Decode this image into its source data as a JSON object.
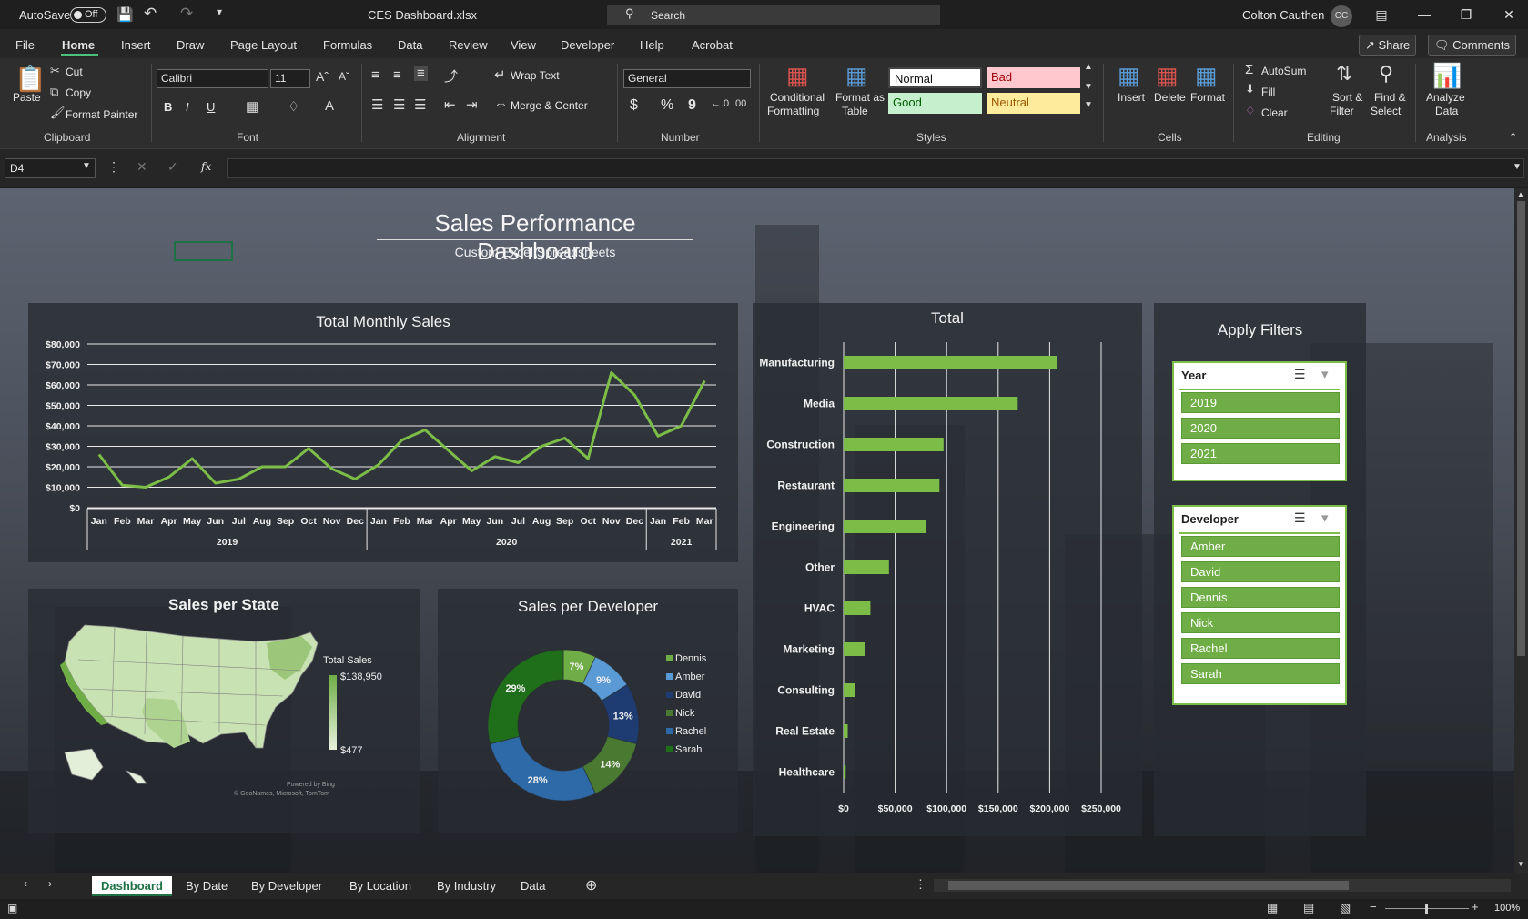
{
  "titlebar": {
    "autosave_label": "AutoSave",
    "autosave_state": "Off",
    "filename": "CES Dashboard.xlsx",
    "search_placeholder": "Search",
    "user_name": "Colton Cauthen",
    "user_initials": "CC"
  },
  "menu": {
    "items": [
      "File",
      "Home",
      "Insert",
      "Draw",
      "Page Layout",
      "Formulas",
      "Data",
      "Review",
      "View",
      "Developer",
      "Help",
      "Acrobat"
    ],
    "active": "Home",
    "share_label": "Share",
    "comments_label": "Comments"
  },
  "ribbon": {
    "clipboard": {
      "paste": "Paste",
      "cut": "Cut",
      "copy": "Copy",
      "format_painter": "Format Painter",
      "label": "Clipboard"
    },
    "font": {
      "name": "Calibri",
      "size": "11",
      "label": "Font",
      "bold": "B",
      "italic": "I",
      "underline": "U"
    },
    "alignment": {
      "wrap_text": "Wrap Text",
      "merge_center": "Merge & Center",
      "label": "Alignment"
    },
    "number": {
      "format": "General",
      "label": "Number",
      "currency": "$",
      "percent": "%",
      "comma": "9"
    },
    "styles": {
      "conditional_formatting": [
        "Conditional",
        "Formatting"
      ],
      "format_as_table": [
        "Format as",
        "Table"
      ],
      "normal": "Normal",
      "bad": "Bad",
      "good": "Good",
      "neutral": "Neutral",
      "label": "Styles"
    },
    "cells": {
      "insert": "Insert",
      "delete": "Delete",
      "format": "Format",
      "label": "Cells"
    },
    "editing": {
      "autosum": "AutoSum",
      "fill": "Fill",
      "clear": "Clear",
      "sort_filter": [
        "Sort &",
        "Filter"
      ],
      "find_select": [
        "Find &",
        "Select"
      ],
      "label": "Editing"
    },
    "analysis": {
      "analyze_data": [
        "Analyze",
        "Data"
      ],
      "label": "Analysis"
    }
  },
  "formula_bar": {
    "name_box": "D4",
    "fx": "fx",
    "value": ""
  },
  "dashboard": {
    "title": "Sales Performance Dashboard",
    "subtitle": "Custom Excel Spreadsheets",
    "filters_title": "Apply Filters",
    "map_title": "Sales per State",
    "map_legend_title": "Total Sales",
    "map_legend_max": "$138,950",
    "map_legend_min": "$477",
    "map_credit_1": "Powered by Bing",
    "map_credit_2": "© GeoNames, Microsoft, TomTom"
  },
  "slicers": {
    "year": {
      "title": "Year",
      "items": [
        "2019",
        "2020",
        "2021"
      ]
    },
    "developer": {
      "title": "Developer",
      "items": [
        "Amber",
        "David",
        "Dennis",
        "Nick",
        "Rachel",
        "Sarah"
      ]
    }
  },
  "chart_data": [
    {
      "type": "line",
      "title": "Total Monthly Sales",
      "x": [
        "Jan",
        "Feb",
        "Mar",
        "Apr",
        "May",
        "Jun",
        "Jul",
        "Aug",
        "Sep",
        "Oct",
        "Nov",
        "Dec",
        "Jan",
        "Feb",
        "Mar",
        "Apr",
        "May",
        "Jun",
        "Jul",
        "Aug",
        "Sep",
        "Oct",
        "Nov",
        "Dec",
        "Jan",
        "Feb",
        "Mar"
      ],
      "x_groups": [
        {
          "label": "2019",
          "count": 12
        },
        {
          "label": "2020",
          "count": 12
        },
        {
          "label": "2021",
          "count": 3
        }
      ],
      "values": [
        26000,
        11000,
        10000,
        15000,
        24000,
        12000,
        14000,
        20000,
        20000,
        29000,
        19000,
        14000,
        21000,
        33000,
        38000,
        28000,
        18000,
        25000,
        22000,
        30000,
        34000,
        24000,
        66000,
        55000,
        35000,
        40000,
        62000
      ],
      "ylim": [
        0,
        80000
      ],
      "yticks": [
        "$0",
        "$10,000",
        "$20,000",
        "$30,000",
        "$40,000",
        "$50,000",
        "$60,000",
        "$70,000",
        "$80,000"
      ],
      "color": "#7cbd48",
      "grid": true
    },
    {
      "type": "bar",
      "orientation": "horizontal",
      "title": "Total",
      "categories": [
        "Manufacturing",
        "Media",
        "Construction",
        "Restaurant",
        "Engineering",
        "Other",
        "HVAC",
        "Marketing",
        "Consulting",
        "Real Estate",
        "Healthcare"
      ],
      "values": [
        207000,
        169000,
        97000,
        93000,
        80000,
        44000,
        26000,
        21000,
        11000,
        4000,
        2000
      ],
      "xlim": [
        0,
        250000
      ],
      "xticks": [
        "$0",
        "$50,000",
        "$100,000",
        "$150,000",
        "$200,000",
        "$250,000"
      ],
      "color": "#7cbd48",
      "grid": true
    },
    {
      "type": "pie",
      "variant": "donut",
      "title": "Sales per Developer",
      "series": [
        {
          "name": "Dennis",
          "value": 7,
          "label": "7%",
          "color": "#6fad46"
        },
        {
          "name": "Amber",
          "value": 9,
          "label": "9%",
          "color": "#5b9bd5"
        },
        {
          "name": "David",
          "value": 13,
          "label": "13%",
          "color": "#1e3c72"
        },
        {
          "name": "Nick",
          "value": 14,
          "label": "14%",
          "color": "#4a7a32"
        },
        {
          "name": "Rachel",
          "value": 28,
          "label": "28%",
          "color": "#2e6aa8"
        },
        {
          "name": "Sarah",
          "value": 29,
          "label": "29%",
          "color": "#1f6e1a"
        }
      ],
      "legend": "right"
    }
  ],
  "sheet_tabs": {
    "items": [
      "Dashboard",
      "By Date",
      "By Developer",
      "By Location",
      "By Industry",
      "Data"
    ],
    "active": "Dashboard"
  },
  "status": {
    "zoom": "100%"
  }
}
